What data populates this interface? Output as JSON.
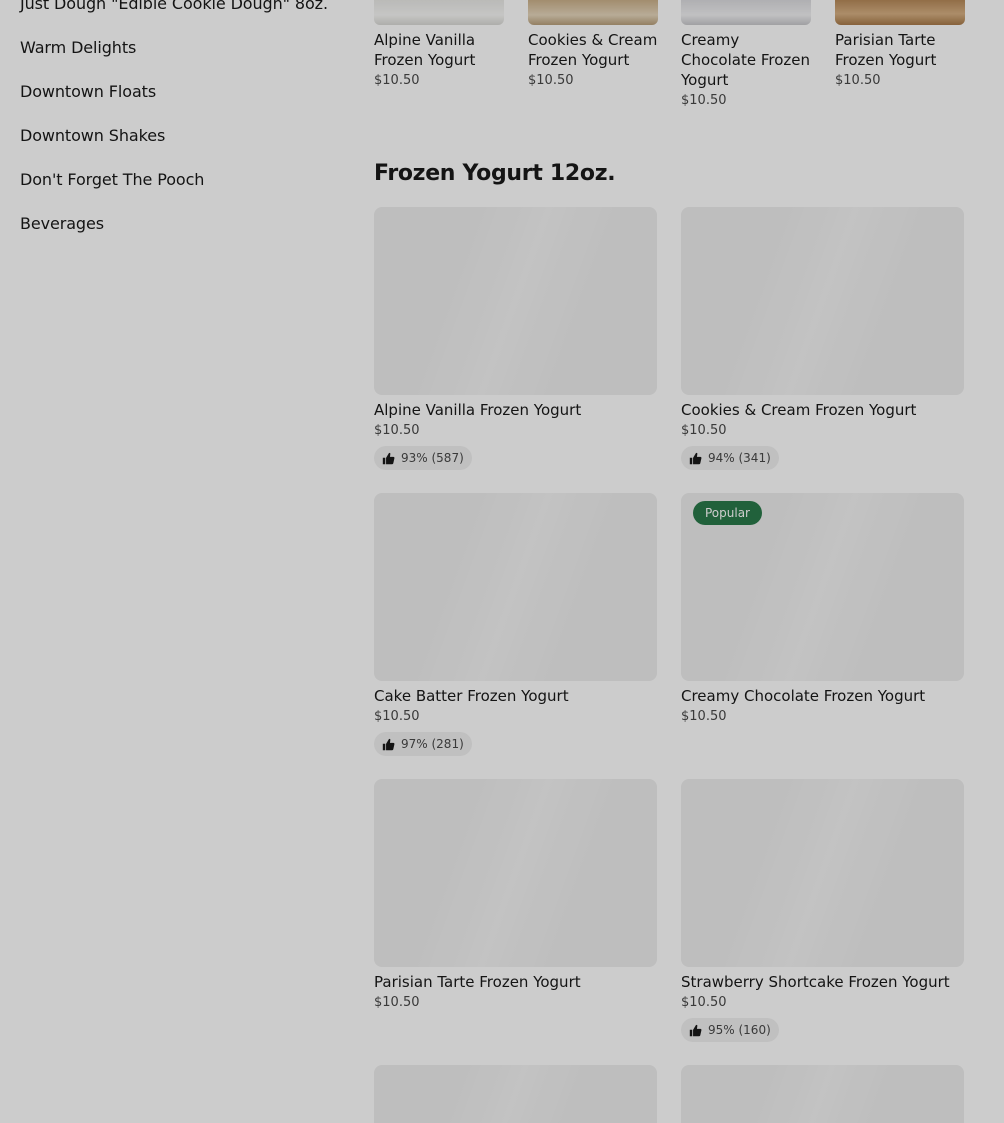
{
  "sidebar": {
    "items": [
      {
        "label": "Just Dough \"Edible Cookie Dough\" 8oz."
      },
      {
        "label": "Warm Delights"
      },
      {
        "label": "Downtown Floats"
      },
      {
        "label": "Downtown Shakes"
      },
      {
        "label": "Don't Forget The Pooch"
      },
      {
        "label": "Beverages"
      }
    ]
  },
  "top_row": {
    "items": [
      {
        "title": "Alpine Vanilla Frozen Yogurt",
        "price": "$10.50",
        "image_color": "#f3f3f1"
      },
      {
        "title": "Cookies & Cream Frozen Yogurt",
        "price": "$10.50",
        "image_color": "#d8c4a2"
      },
      {
        "title": "Creamy Chocolate Frozen Yogurt",
        "price": "$10.50",
        "image_color": "#e8e8ea"
      },
      {
        "title": "Parisian Tarte Frozen Yogurt",
        "price": "$10.50",
        "image_color": "#c79a68"
      }
    ]
  },
  "section": {
    "title": "Frozen Yogurt 12oz."
  },
  "products": [
    {
      "title": "Alpine Vanilla Frozen Yogurt",
      "price": "$10.50",
      "rating": "93% (587)"
    },
    {
      "title": "Cookies & Cream Frozen Yogurt",
      "price": "$10.50",
      "rating": "94% (341)"
    },
    {
      "title": "Cake Batter Frozen Yogurt",
      "price": "$10.50",
      "rating": "97% (281)"
    },
    {
      "title": "Creamy Chocolate Frozen Yogurt",
      "price": "$10.50",
      "badge": "Popular"
    },
    {
      "title": "Parisian Tarte Frozen Yogurt",
      "price": "$10.50"
    },
    {
      "title": "Strawberry Shortcake Frozen Yogurt",
      "price": "$10.50",
      "rating": "95% (160)"
    }
  ],
  "colors": {
    "overlay": "rgba(0,0,0,0.2)",
    "popular_badge": "#2a7a4a",
    "placeholder": "#eeeeee"
  },
  "icons": {
    "rating": "thumbs-up-icon"
  }
}
